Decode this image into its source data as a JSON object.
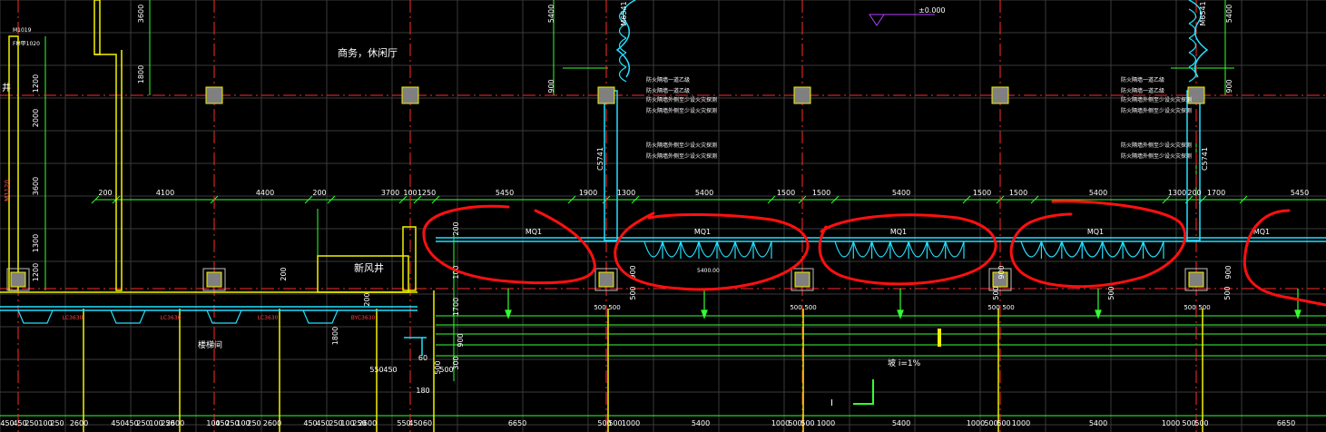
{
  "rooms": {
    "lounge_label": "商务，休闲厅",
    "fresh_air_shaft_label": "新风井",
    "fire_shaft_label": "井",
    "left_stair_label": "楼梯间"
  },
  "door_tags": [
    "MQ1",
    "MQ1",
    "MQ1",
    "MQ1",
    "MQ1"
  ],
  "wall_tags": [
    "M6541",
    "M6541",
    "C5741",
    "C5741"
  ],
  "left_tags": [
    "M1019",
    "FM甲1020",
    "M1120"
  ],
  "window_tags": [
    "LC3630",
    "LC3630",
    "LC3630",
    "BYC3630"
  ],
  "elevation_tag": "±0.000",
  "slope_note": "坡 i=1%",
  "small_note": "5400.00",
  "dim_top_row": [
    "200",
    "4100",
    "4400",
    "200",
    "3700",
    "100",
    "1250",
    "5450",
    "1900",
    "1300",
    "5400",
    "1500",
    "1500",
    "5400",
    "1500",
    "1500",
    "5400",
    "1300",
    "200",
    "1700",
    "5450"
  ],
  "dim_bottom_row": [
    "450",
    "450",
    "250",
    "100",
    "250",
    "2600",
    "450",
    "450",
    "250",
    "100",
    "250",
    "2600",
    "100",
    "450",
    "250",
    "100",
    "250",
    "2600",
    "450",
    "450",
    "250",
    "100",
    "250",
    "2600",
    "550",
    "450",
    "60",
    "6650",
    "500",
    "500",
    "1000",
    "5400",
    "1000",
    "500",
    "500",
    "1000",
    "5400",
    "1000",
    "500",
    "500",
    "1000",
    "5400",
    "1000",
    "500",
    "500",
    "6650"
  ],
  "dim_vertical_left": [
    "1200",
    "2000",
    "3600",
    "1300",
    "1200"
  ],
  "dim_vertical_upper": [
    "3600",
    "1800",
    "5400",
    "900",
    "900",
    "5400"
  ],
  "dim_vertical_lower": [
    "200",
    "100",
    "200",
    "1700",
    "1800",
    "200",
    "900",
    "500",
    "500",
    "900",
    "500",
    "900",
    "500",
    "900",
    "300",
    "500"
  ],
  "dim_misc": [
    "60",
    "180",
    "550",
    "450",
    "500"
  ],
  "fire_notes": [
    "防火隔墙一道乙级",
    "防火隔墙外侧至少设火灾探测",
    "防火隔墙外侧至少设火灾探测"
  ],
  "colors": {
    "background": "#000000",
    "axis_red": "#ff2a2a",
    "dim_green": "#33ff33",
    "wall_yellow": "#f2f200",
    "curtain_cyan": "#22e0ff",
    "column_gray": "#808080",
    "markup_red": "#ff1010",
    "grid_gray": "#3a3a3a"
  }
}
